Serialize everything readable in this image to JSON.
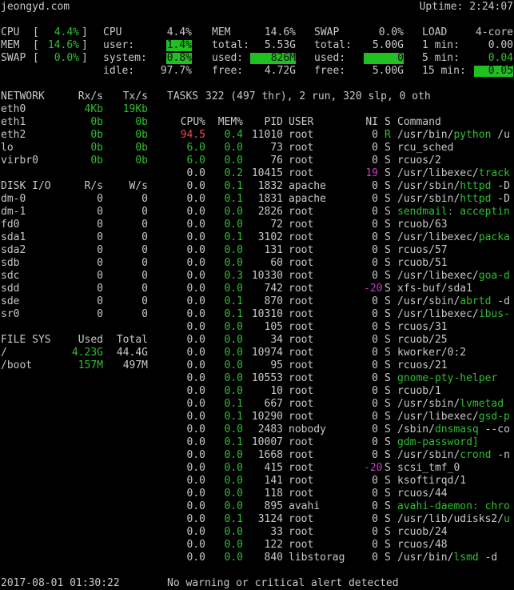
{
  "header": {
    "hostname": "jeongyd.com",
    "uptime": "Uptime: 2:24:07"
  },
  "quick": {
    "cpu": {
      "label": "CPU",
      "value": "4.4%"
    },
    "mem": {
      "label": "MEM",
      "value": "14.6%"
    },
    "swap": {
      "label": "SWAP",
      "value": "0.0%"
    }
  },
  "cpu": {
    "title": "CPU",
    "total": "4.4%",
    "rows": [
      {
        "k": "user:",
        "v": "1.4%"
      },
      {
        "k": "system:",
        "v": "0.8%"
      },
      {
        "k": "idle:",
        "v": "97.7%"
      }
    ]
  },
  "mem": {
    "title": "MEM",
    "total": "14.6%",
    "rows": [
      {
        "k": "total:",
        "v": "5.53G"
      },
      {
        "k": "used:",
        "v": "826M"
      },
      {
        "k": "free:",
        "v": "4.72G"
      }
    ]
  },
  "swap": {
    "title": "SWAP",
    "total": "0.0%",
    "rows": [
      {
        "k": "total:",
        "v": "5.00G"
      },
      {
        "k": "used:",
        "v": "0"
      },
      {
        "k": "free:",
        "v": "5.00G"
      }
    ]
  },
  "load": {
    "title": "LOAD",
    "cores": "4-core",
    "rows": [
      {
        "k": "1 min:",
        "v": "0.00"
      },
      {
        "k": "5 min:",
        "v": "0.04"
      },
      {
        "k": "15 min:",
        "v": "0.05"
      }
    ]
  },
  "network": {
    "headers": [
      "NETWORK",
      "Rx/s",
      "Tx/s"
    ],
    "rows": [
      {
        "name": "eth0",
        "rx": "4Kb",
        "tx": "19Kb"
      },
      {
        "name": "eth1",
        "rx": "0b",
        "tx": "0b"
      },
      {
        "name": "eth2",
        "rx": "0b",
        "tx": "0b"
      },
      {
        "name": "lo",
        "rx": "0b",
        "tx": "0b"
      },
      {
        "name": "virbr0",
        "rx": "0b",
        "tx": "0b"
      }
    ]
  },
  "disk": {
    "headers": [
      "DISK I/O",
      "R/s",
      "W/s"
    ],
    "rows": [
      {
        "name": "dm-0",
        "r": "0",
        "w": "0"
      },
      {
        "name": "dm-1",
        "r": "0",
        "w": "0"
      },
      {
        "name": "fd0",
        "r": "0",
        "w": "0"
      },
      {
        "name": "sda1",
        "r": "0",
        "w": "0"
      },
      {
        "name": "sda2",
        "r": "0",
        "w": "0"
      },
      {
        "name": "sdb",
        "r": "0",
        "w": "0"
      },
      {
        "name": "sdc",
        "r": "0",
        "w": "0"
      },
      {
        "name": "sdd",
        "r": "0",
        "w": "0"
      },
      {
        "name": "sde",
        "r": "0",
        "w": "0"
      },
      {
        "name": "sr0",
        "r": "0",
        "w": "0"
      }
    ]
  },
  "fs": {
    "headers": [
      "FILE SYS",
      "Used",
      "Total"
    ],
    "rows": [
      {
        "name": "/",
        "used": "4.23G",
        "total": "44.4G"
      },
      {
        "name": "/boot",
        "used": "157M",
        "total": "497M"
      }
    ]
  },
  "tasks": {
    "label": "TASKS",
    "summary": "322 (497 thr), 2 run, 320 slp, 0 oth"
  },
  "proc": {
    "headers": {
      "cpu": "CPU%",
      "mem": "MEM%",
      "pid": "PID",
      "user": "USER",
      "ni": "NI",
      "s": "S",
      "cmd": "Command"
    },
    "rows": [
      {
        "cpu": "94.5",
        "mem": "0.4",
        "pid": "11010",
        "user": "root",
        "ni": "0",
        "s": "R",
        "bin": "/usr/bin/",
        "name": "python",
        "rest": " /u"
      },
      {
        "cpu": "6.0",
        "mem": "0.0",
        "pid": "73",
        "user": "root",
        "ni": "0",
        "s": "S",
        "bin": "",
        "name": "",
        "rest": "rcu_sched"
      },
      {
        "cpu": "6.0",
        "mem": "0.0",
        "pid": "76",
        "user": "root",
        "ni": "0",
        "s": "S",
        "bin": "",
        "name": "",
        "rest": "rcuos/2"
      },
      {
        "cpu": "0.0",
        "mem": "0.2",
        "pid": "10415",
        "user": "root",
        "ni": "19",
        "s": "S",
        "bin": "/usr/libexec/",
        "name": "track",
        "rest": ""
      },
      {
        "cpu": "0.0",
        "mem": "0.1",
        "pid": "1832",
        "user": "apache",
        "ni": "0",
        "s": "S",
        "bin": "/usr/sbin/",
        "name": "httpd",
        "rest": " -D"
      },
      {
        "cpu": "0.0",
        "mem": "0.1",
        "pid": "1831",
        "user": "apache",
        "ni": "0",
        "s": "S",
        "bin": "/usr/sbin/",
        "name": "httpd",
        "rest": " -D"
      },
      {
        "cpu": "0.0",
        "mem": "0.0",
        "pid": "2826",
        "user": "root",
        "ni": "0",
        "s": "S",
        "bin": "",
        "name": "sendmail: acceptin",
        "rest": ""
      },
      {
        "cpu": "0.0",
        "mem": "0.0",
        "pid": "72",
        "user": "root",
        "ni": "0",
        "s": "S",
        "bin": "",
        "name": "",
        "rest": "rcuob/63"
      },
      {
        "cpu": "0.0",
        "mem": "0.1",
        "pid": "3102",
        "user": "root",
        "ni": "0",
        "s": "S",
        "bin": "/usr/libexec/",
        "name": "packa",
        "rest": ""
      },
      {
        "cpu": "0.0",
        "mem": "0.0",
        "pid": "131",
        "user": "root",
        "ni": "0",
        "s": "S",
        "bin": "",
        "name": "",
        "rest": "rcuos/57"
      },
      {
        "cpu": "0.0",
        "mem": "0.0",
        "pid": "60",
        "user": "root",
        "ni": "0",
        "s": "S",
        "bin": "",
        "name": "",
        "rest": "rcuob/51"
      },
      {
        "cpu": "0.0",
        "mem": "0.3",
        "pid": "10330",
        "user": "root",
        "ni": "0",
        "s": "S",
        "bin": "/usr/libexec/",
        "name": "goa-d",
        "rest": ""
      },
      {
        "cpu": "0.0",
        "mem": "0.0",
        "pid": "742",
        "user": "root",
        "ni": "-20",
        "s": "S",
        "bin": "",
        "name": "",
        "rest": "xfs-buf/sda1"
      },
      {
        "cpu": "0.0",
        "mem": "0.1",
        "pid": "870",
        "user": "root",
        "ni": "0",
        "s": "S",
        "bin": "/usr/sbin/",
        "name": "abrtd",
        "rest": " -d"
      },
      {
        "cpu": "0.0",
        "mem": "0.1",
        "pid": "10310",
        "user": "root",
        "ni": "0",
        "s": "S",
        "bin": "/usr/libexec/",
        "name": "ibus-",
        "rest": ""
      },
      {
        "cpu": "0.0",
        "mem": "0.0",
        "pid": "105",
        "user": "root",
        "ni": "0",
        "s": "S",
        "bin": "",
        "name": "",
        "rest": "rcuos/31"
      },
      {
        "cpu": "0.0",
        "mem": "0.0",
        "pid": "34",
        "user": "root",
        "ni": "0",
        "s": "S",
        "bin": "",
        "name": "",
        "rest": "rcuob/25"
      },
      {
        "cpu": "0.0",
        "mem": "0.0",
        "pid": "10974",
        "user": "root",
        "ni": "0",
        "s": "S",
        "bin": "",
        "name": "",
        "rest": "kworker/0:2"
      },
      {
        "cpu": "0.0",
        "mem": "0.0",
        "pid": "95",
        "user": "root",
        "ni": "0",
        "s": "S",
        "bin": "",
        "name": "",
        "rest": "rcuos/21"
      },
      {
        "cpu": "0.0",
        "mem": "0.0",
        "pid": "10553",
        "user": "root",
        "ni": "0",
        "s": "S",
        "bin": "",
        "name": "gnome-pty-helper",
        "rest": ""
      },
      {
        "cpu": "0.0",
        "mem": "0.0",
        "pid": "10",
        "user": "root",
        "ni": "0",
        "s": "S",
        "bin": "",
        "name": "",
        "rest": "rcuob/1"
      },
      {
        "cpu": "0.0",
        "mem": "0.1",
        "pid": "667",
        "user": "root",
        "ni": "0",
        "s": "S",
        "bin": "/usr/sbin/",
        "name": "lvmetad",
        "rest": ""
      },
      {
        "cpu": "0.0",
        "mem": "0.1",
        "pid": "10290",
        "user": "root",
        "ni": "0",
        "s": "S",
        "bin": "/usr/libexec/",
        "name": "gsd-p",
        "rest": ""
      },
      {
        "cpu": "0.0",
        "mem": "0.0",
        "pid": "2483",
        "user": "nobody",
        "ni": "0",
        "s": "S",
        "bin": "/sbin/",
        "name": "dnsmasq",
        "rest": " --co"
      },
      {
        "cpu": "0.0",
        "mem": "0.1",
        "pid": "10007",
        "user": "root",
        "ni": "0",
        "s": "S",
        "bin": "",
        "name": "gdm-password]",
        "rest": ""
      },
      {
        "cpu": "0.0",
        "mem": "0.0",
        "pid": "1668",
        "user": "root",
        "ni": "0",
        "s": "S",
        "bin": "/usr/sbin/",
        "name": "crond",
        "rest": " -n"
      },
      {
        "cpu": "0.0",
        "mem": "0.0",
        "pid": "415",
        "user": "root",
        "ni": "-20",
        "s": "S",
        "bin": "",
        "name": "",
        "rest": "scsi_tmf_0"
      },
      {
        "cpu": "0.0",
        "mem": "0.0",
        "pid": "141",
        "user": "root",
        "ni": "0",
        "s": "S",
        "bin": "",
        "name": "",
        "rest": "ksoftirqd/1"
      },
      {
        "cpu": "0.0",
        "mem": "0.0",
        "pid": "118",
        "user": "root",
        "ni": "0",
        "s": "S",
        "bin": "",
        "name": "",
        "rest": "rcuos/44"
      },
      {
        "cpu": "0.0",
        "mem": "0.0",
        "pid": "895",
        "user": "avahi",
        "ni": "0",
        "s": "S",
        "bin": "",
        "name": "avahi-daemon: chro",
        "rest": ""
      },
      {
        "cpu": "0.0",
        "mem": "0.1",
        "pid": "3124",
        "user": "root",
        "ni": "0",
        "s": "S",
        "bin": "/usr/lib/udisks2/",
        "name": "u",
        "rest": ""
      },
      {
        "cpu": "0.0",
        "mem": "0.0",
        "pid": "33",
        "user": "root",
        "ni": "0",
        "s": "S",
        "bin": "",
        "name": "",
        "rest": "rcuob/24"
      },
      {
        "cpu": "0.0",
        "mem": "0.0",
        "pid": "122",
        "user": "root",
        "ni": "0",
        "s": "S",
        "bin": "",
        "name": "",
        "rest": "rcuos/48"
      },
      {
        "cpu": "0.0",
        "mem": "0.0",
        "pid": "840",
        "user": "libstorag",
        "ni": "0",
        "s": "S",
        "bin": "/usr/bin/",
        "name": "lsmd",
        "rest": " -d"
      }
    ]
  },
  "footer": {
    "datetime": "2017-08-01 01:30:22",
    "alert": "No warning or critical alert detected"
  },
  "colors": {
    "ok": "#2fbf2f",
    "highlight": "#20c020",
    "careful": "#e05050",
    "nice": "#c23cc2"
  }
}
